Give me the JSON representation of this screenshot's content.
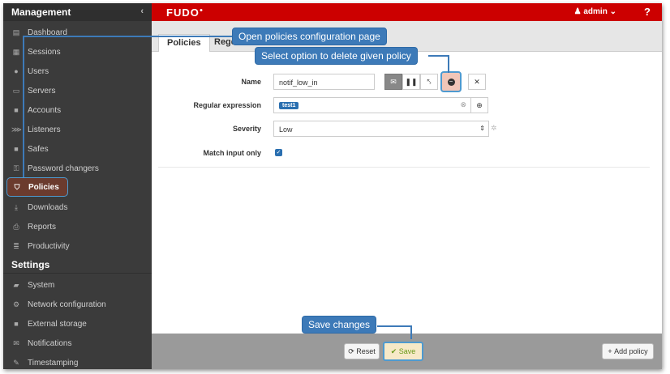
{
  "sidebar": {
    "header": "Management",
    "collapse_icon": "‹",
    "items": [
      {
        "label": "Dashboard",
        "icon": "dashboard-icon"
      },
      {
        "label": "Sessions",
        "icon": "sessions-icon"
      },
      {
        "label": "Users",
        "icon": "users-icon"
      },
      {
        "label": "Servers",
        "icon": "servers-icon"
      },
      {
        "label": "Accounts",
        "icon": "accounts-icon"
      },
      {
        "label": "Listeners",
        "icon": "listeners-icon"
      },
      {
        "label": "Safes",
        "icon": "safes-icon"
      },
      {
        "label": "Password changers",
        "icon": "password-changers-icon"
      },
      {
        "label": "Policies",
        "icon": "policies-icon"
      },
      {
        "label": "Downloads",
        "icon": "downloads-icon"
      },
      {
        "label": "Reports",
        "icon": "reports-icon"
      },
      {
        "label": "Productivity",
        "icon": "productivity-icon"
      }
    ],
    "settings_header": "Settings",
    "settings_items": [
      {
        "label": "System",
        "icon": "system-icon"
      },
      {
        "label": "Network configuration",
        "icon": "network-icon"
      },
      {
        "label": "External storage",
        "icon": "storage-icon"
      },
      {
        "label": "Notifications",
        "icon": "notifications-icon"
      },
      {
        "label": "Timestamping",
        "icon": "timestamping-icon"
      }
    ]
  },
  "topbar": {
    "logo": "FUDO",
    "user": "admin",
    "help": "?",
    "accent_color": "#cc0000"
  },
  "tabs": {
    "active": "Policies",
    "other": "Rege"
  },
  "form": {
    "name_label": "Name",
    "name_value": "notif_low_in",
    "regex_label": "Regular expression",
    "regex_tag": "test1",
    "severity_label": "Severity",
    "severity_value": "Low",
    "match_label": "Match input only",
    "match_checked": true
  },
  "footer": {
    "reset": "Reset",
    "save": "Save",
    "add_policy": "Add policy"
  },
  "callouts": {
    "open_policies": "Open policies configuration page",
    "delete_policy": "Select option to delete given policy",
    "save_changes": "Save changes"
  }
}
